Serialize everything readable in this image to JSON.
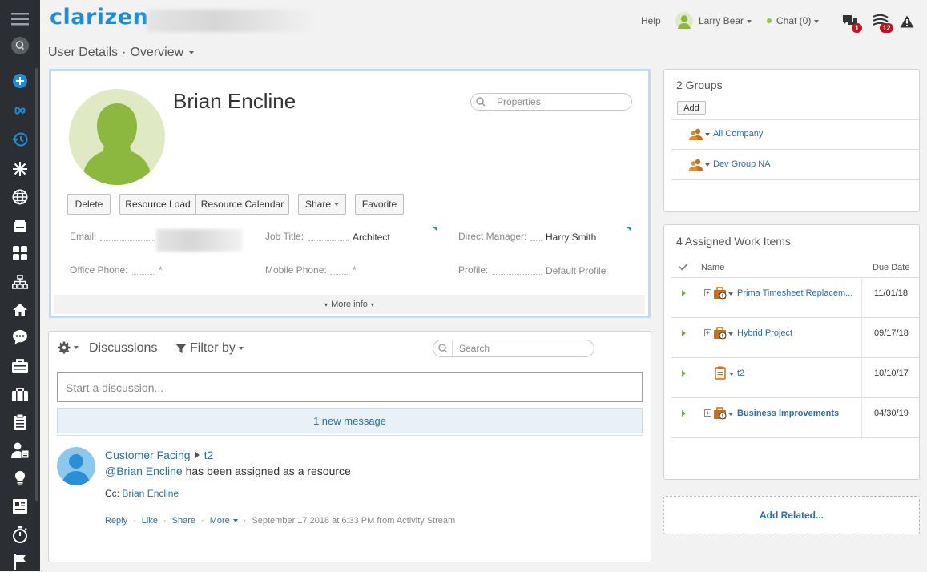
{
  "app": {
    "logo": "clarizen"
  },
  "topbar": {
    "help": "Help",
    "user_name": "Larry Bear",
    "chat": "Chat (0)",
    "comments_badge": "1",
    "stream_badge": "12"
  },
  "breadcrumb": {
    "section": "User Details",
    "separator": "·",
    "view": "Overview"
  },
  "profile": {
    "name": "Brian Encline",
    "properties_placeholder": "Properties",
    "buttons": {
      "delete": "Delete",
      "resource_load": "Resource Load",
      "resource_calendar": "Resource Calendar",
      "share": "Share",
      "favorite": "Favorite"
    },
    "fields": {
      "email_label": "Email:",
      "job_title_label": "Job Title:",
      "job_title": "Architect",
      "direct_manager_label": "Direct Manager:",
      "direct_manager": "Harry Smith",
      "office_phone_label": "Office Phone:",
      "office_phone": "*",
      "mobile_phone_label": "Mobile Phone:",
      "mobile_phone": "*",
      "profile_label": "Profile:",
      "profile": "Default Profile"
    },
    "more_info": "More info"
  },
  "discussions": {
    "title": "Discussions",
    "filter": "Filter by",
    "search_placeholder": "Search",
    "start_placeholder": "Start a discussion...",
    "new_message": "1 new message",
    "post": {
      "source": "Customer Facing",
      "target": "t2",
      "mention": "@Brian Encline",
      "text": "has been assigned as a resource",
      "cc_label": "Cc:",
      "cc_name": "Brian Encline",
      "actions": {
        "reply": "Reply",
        "like": "Like",
        "share": "Share",
        "more": "More"
      },
      "meta": "September 17 2018 at 6:33 PM from Activity Stream"
    }
  },
  "groups": {
    "title": "2 Groups",
    "add": "Add",
    "items": [
      {
        "name": "All Company"
      },
      {
        "name": "Dev Group NA"
      }
    ]
  },
  "work_items": {
    "title": "4 Assigned Work Items",
    "col_name": "Name",
    "col_due": "Due Date",
    "items": [
      {
        "name": "Prima Timesheet Replacem...",
        "due": "11/01/18",
        "icon": "project-icon",
        "bold": false
      },
      {
        "name": "Hybrid Project",
        "due": "09/17/18",
        "icon": "project-icon",
        "bold": false
      },
      {
        "name": "t2",
        "due": "10/10/17",
        "icon": "task-icon",
        "bold": false
      },
      {
        "name": "Business Improvements",
        "due": "04/30/19",
        "icon": "project-icon",
        "bold": true
      }
    ]
  },
  "add_related": "Add Related...",
  "colors": {
    "accent": "#1f8dd6",
    "green": "#8cc63f",
    "link": "#2a6ea7",
    "sidebar": "#2b2f33"
  }
}
